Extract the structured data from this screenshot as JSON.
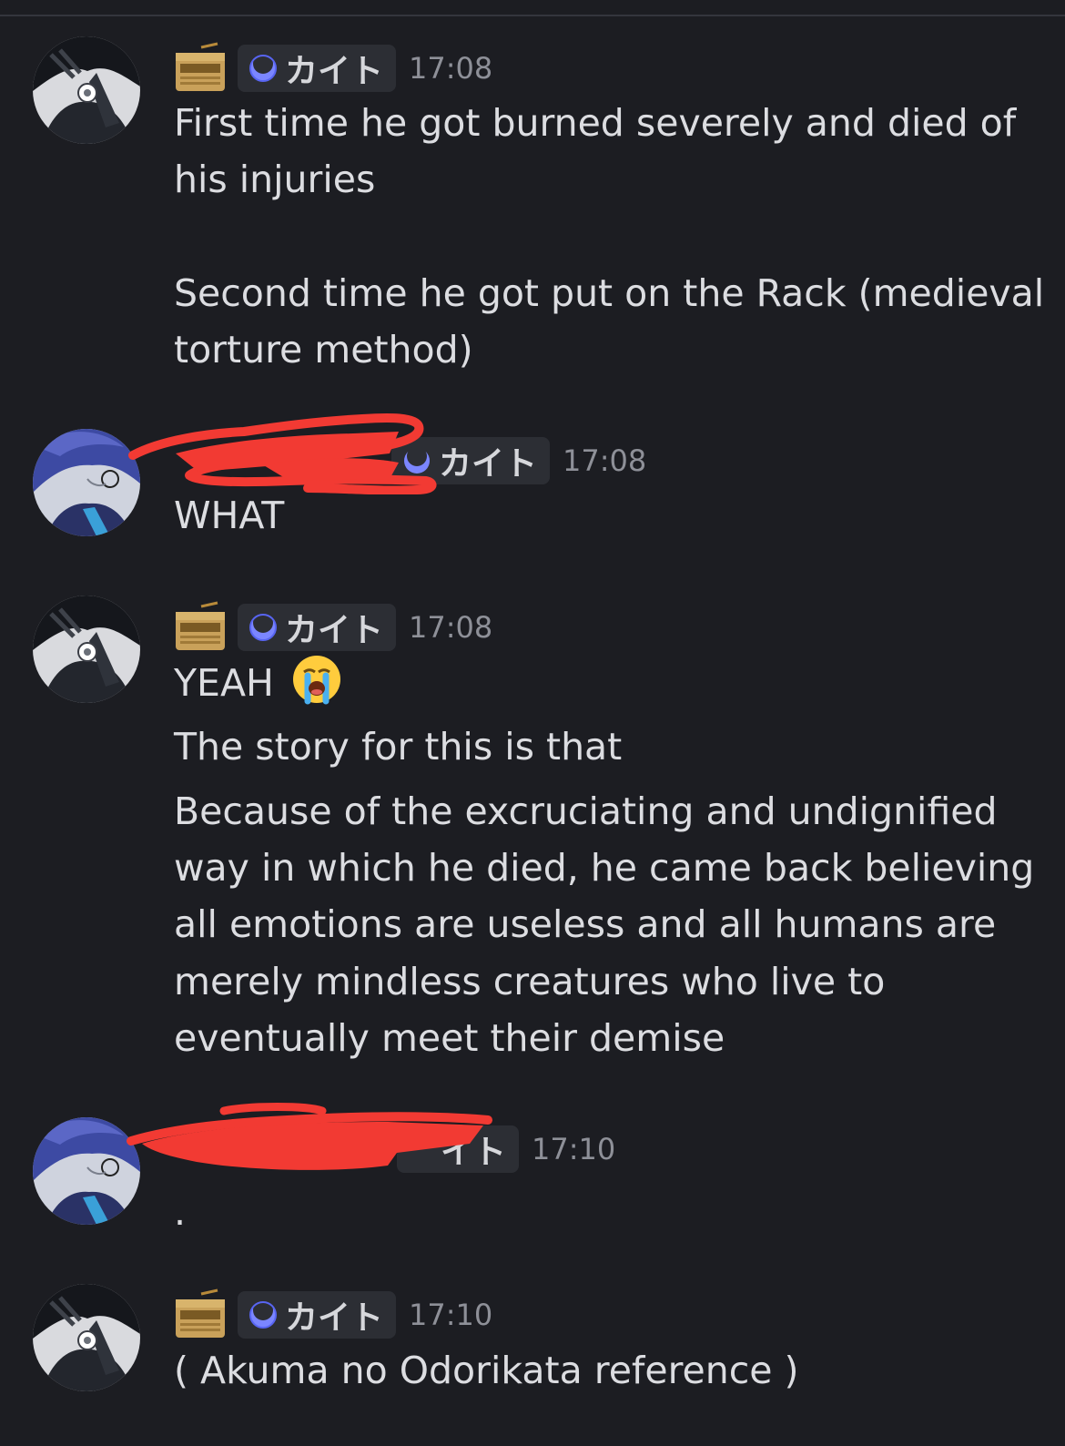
{
  "messages": [
    {
      "author": "カイト",
      "time": "17:08",
      "lines": [
        "First time he got burned severely and died of",
        "his injuries",
        "",
        "Second time he got put on the Rack (medieval",
        "torture method)"
      ]
    },
    {
      "author": "カイト",
      "time": "17:08",
      "lines": [
        "WHAT"
      ]
    },
    {
      "author": "カイト",
      "time": "17:08",
      "lines": [
        "YEAH",
        "The story for this is that",
        "Because of the excruciating and undignified",
        "way in which he died, he came back believing",
        "all emotions are useless and all humans are",
        "merely mindless creatures who live to",
        "eventually meet their demise"
      ],
      "emoji": "loudly-crying-face-icon"
    },
    {
      "author": "イト",
      "time": "17:10",
      "lines": [
        "."
      ]
    },
    {
      "author": "カイト",
      "time": "17:10",
      "lines": [
        "( Akuma no Odorikata reference )"
      ]
    }
  ],
  "colors": {
    "background": "#1c1d22",
    "tag_background": "#2c2e34",
    "text": "#dcdde1",
    "timestamp": "#8e9098",
    "redaction": "#f23a33",
    "moon": "#5865f2"
  }
}
